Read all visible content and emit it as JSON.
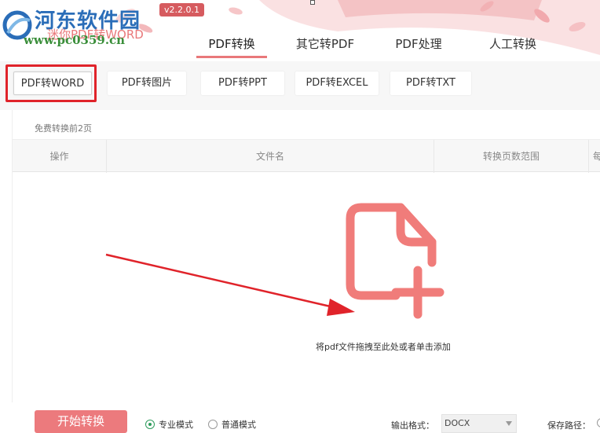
{
  "app": {
    "watermark_site": "河东软件园",
    "app_name": "迷你PDF转WORD",
    "watermark_url": "www.pc0359.cn",
    "version": "v2.2.0.1"
  },
  "main_tabs": [
    {
      "label": "PDF转换",
      "active": true
    },
    {
      "label": "其它转PDF",
      "active": false
    },
    {
      "label": "PDF处理",
      "active": false
    },
    {
      "label": "人工转换",
      "active": false
    }
  ],
  "sub_tabs": [
    {
      "label": "PDF转WORD",
      "active": true
    },
    {
      "label": "PDF转图片",
      "active": false
    },
    {
      "label": "PDF转PPT",
      "active": false
    },
    {
      "label": "PDF转EXCEL",
      "active": false
    },
    {
      "label": "PDF转TXT",
      "active": false
    }
  ],
  "panel": {
    "free_note": "免费转换前2页",
    "columns": [
      "操作",
      "文件名",
      "转换页数范围",
      "每"
    ],
    "drop_text": "将pdf文件拖拽至此处或者单击添加"
  },
  "bottom": {
    "start_label": "开始转换",
    "mode_pro": "专业模式",
    "mode_normal": "普通模式",
    "selected_mode": "专业模式",
    "format_label": "输出格式：",
    "format_value": "DOCX",
    "save_label": "保存路径："
  },
  "colors": {
    "accent": "#ec7a7d",
    "highlight": "#e0232a",
    "icon": "#f07c7a"
  },
  "icons": [
    "file-add-icon",
    "dropdown-caret-icon"
  ]
}
